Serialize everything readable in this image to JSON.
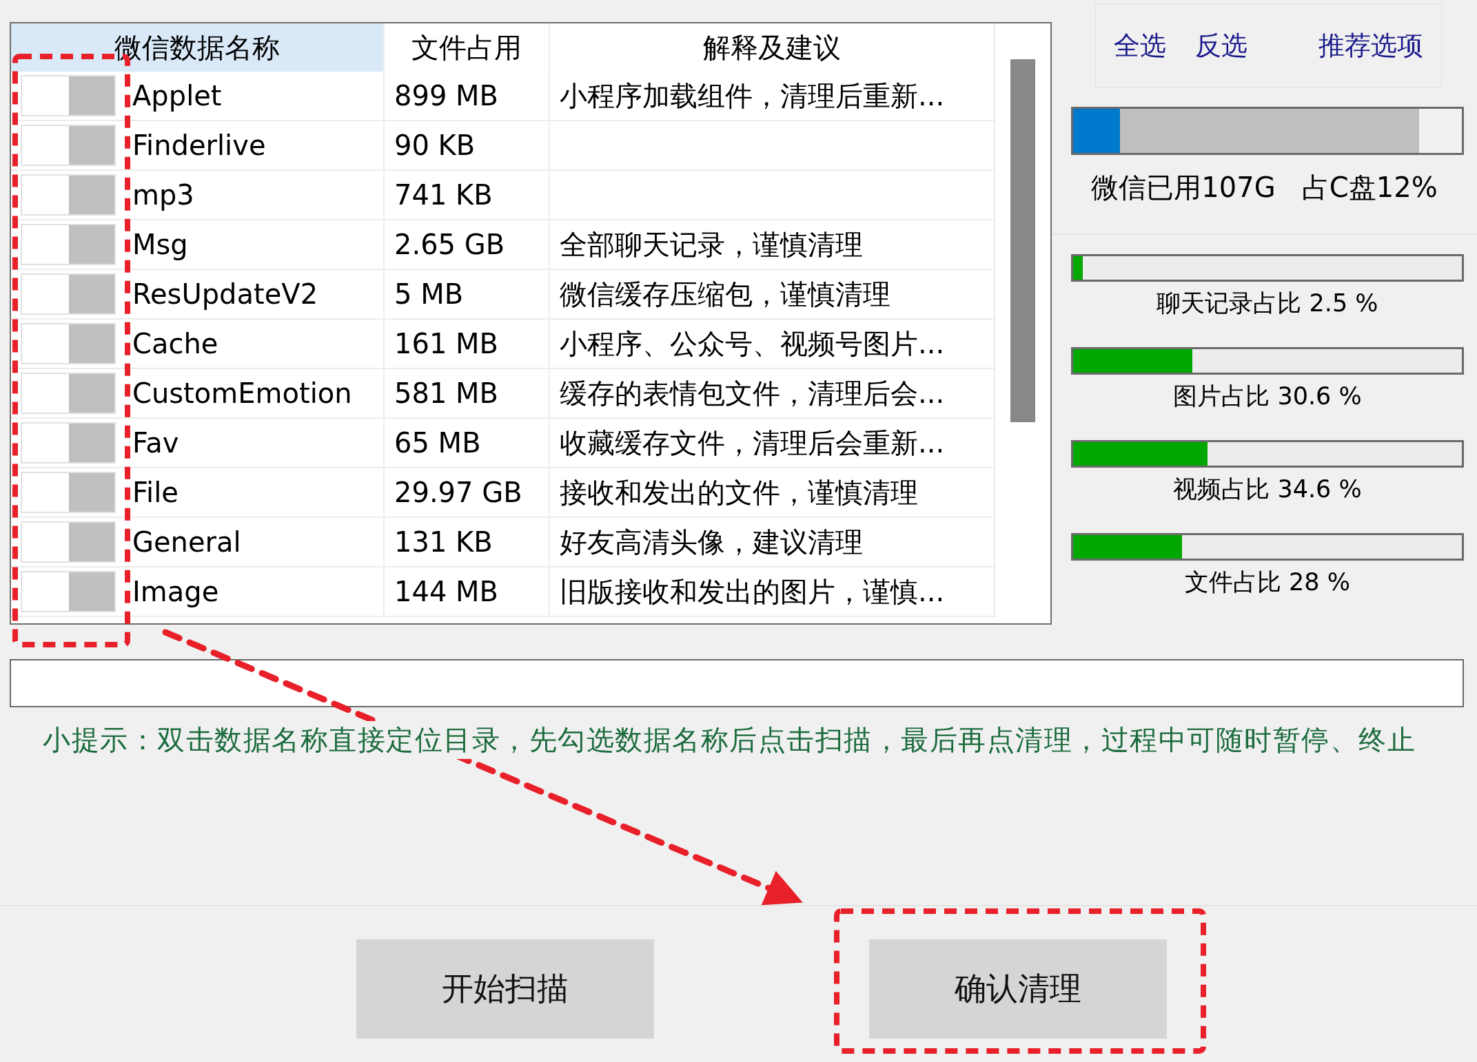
{
  "table": {
    "columns": [
      "微信数据名称",
      "文件占用",
      "解释及建议"
    ],
    "rows": [
      {
        "on": false,
        "name": "Applet",
        "size": "899 MB",
        "advice": "小程序加载组件，清理后重新..."
      },
      {
        "on": false,
        "name": "Finderlive",
        "size": "90 KB",
        "advice": ""
      },
      {
        "on": false,
        "name": "mp3",
        "size": "741 KB",
        "advice": ""
      },
      {
        "on": false,
        "name": "Msg",
        "size": "2.65 GB",
        "advice": "全部聊天记录，谨慎清理"
      },
      {
        "on": false,
        "name": "ResUpdateV2",
        "size": "5 MB",
        "advice": "微信缓存压缩包，谨慎清理"
      },
      {
        "on": false,
        "name": "Cache",
        "size": "161 MB",
        "advice": "小程序、公众号、视频号图片..."
      },
      {
        "on": false,
        "name": "CustomEmotion",
        "size": "581 MB",
        "advice": "缓存的表情包文件，清理后会..."
      },
      {
        "on": false,
        "name": "Fav",
        "size": "65 MB",
        "advice": "收藏缓存文件，清理后会重新..."
      },
      {
        "on": false,
        "name": "File",
        "size": "29.97 GB",
        "advice": "接收和发出的文件，谨慎清理"
      },
      {
        "on": false,
        "name": "General",
        "size": "131 KB",
        "advice": "好友高清头像，建议清理"
      },
      {
        "on": false,
        "name": "Image",
        "size": "144 MB",
        "advice": "旧版接收和发出的图片，谨慎..."
      }
    ]
  },
  "selection_links": [
    "全选",
    "反选",
    "推荐选项"
  ],
  "disk_usage": {
    "segments": [
      {
        "kind": "wechat",
        "level": 0.12
      },
      {
        "kind": "disk",
        "level": 0.89
      }
    ],
    "caption": "微信已用107G   占C盘12%"
  },
  "breakdown": [
    {
      "label": "聊天记录占比 2.5 %",
      "level": 0.025
    },
    {
      "label": "图片占比 30.6 %",
      "level": 0.306
    },
    {
      "label": "视频占比 34.6 %",
      "level": 0.346
    },
    {
      "label": "文件占比 28 %",
      "level": 0.28
    }
  ],
  "hint": "小提示：双击数据名称直接定位目录，先勾选数据名称后点击扫描，最后再点清理，过程中可随时暂停、终止",
  "buttons": [
    "开始扫描",
    "确认清理"
  ]
}
